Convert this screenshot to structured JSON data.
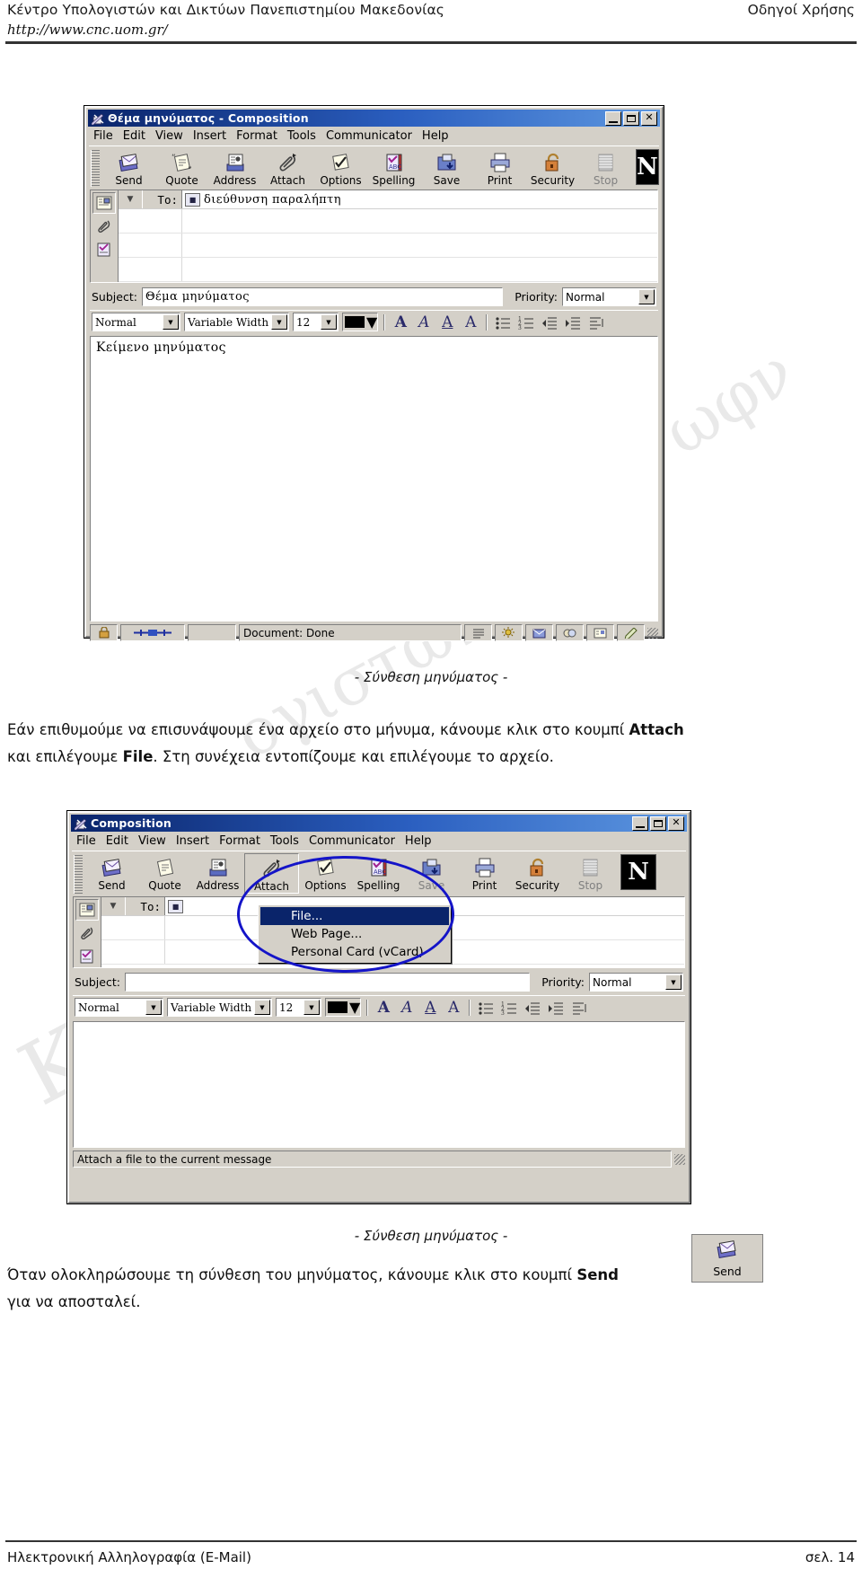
{
  "header": {
    "left": "Κέντρο Υπολογιστών και Δικτύων Πανεπιστημίου Μακεδονίας",
    "right": "Οδηγοί Χρήσης",
    "url": "http://www.cnc.uom.gr/"
  },
  "footer": {
    "left": "Ηλεκτρονική Αλληλογραφία (E-Mail)",
    "right": "σελ. 14"
  },
  "watermarks": [
    "ωφν",
    "ογιστών",
    "Κέν"
  ],
  "window1": {
    "title": "Θέμα μηνύματος - Composition",
    "title_icon": "compose-icon",
    "buttons": {
      "minimize": "_",
      "maximize": "□",
      "close": "✕"
    },
    "menu": [
      "File",
      "Edit",
      "View",
      "Insert",
      "Format",
      "Tools",
      "Communicator",
      "Help"
    ],
    "toolbar": [
      {
        "label": "Send",
        "icon": "send-icon",
        "disabled": false
      },
      {
        "label": "Quote",
        "icon": "quote-icon",
        "disabled": false
      },
      {
        "label": "Address",
        "icon": "address-icon",
        "disabled": false
      },
      {
        "label": "Attach",
        "icon": "attach-icon",
        "disabled": false
      },
      {
        "label": "Options",
        "icon": "options-icon",
        "disabled": false
      },
      {
        "label": "Spelling",
        "icon": "spelling-icon",
        "disabled": false
      },
      {
        "label": "Save",
        "icon": "save-icon",
        "disabled": false
      },
      {
        "label": "Print",
        "icon": "print-icon",
        "disabled": false
      },
      {
        "label": "Security",
        "icon": "security-icon",
        "disabled": false
      },
      {
        "label": "Stop",
        "icon": "stop-icon",
        "disabled": true
      }
    ],
    "logo": "N",
    "address": {
      "side_icons": [
        "address-card-icon",
        "paperclip-icon",
        "options-card-icon"
      ],
      "caret": "▼",
      "to_label": "To:",
      "recipient_icon": "person-card-icon",
      "recipient_value": "διεύθυνση παραλήπτη"
    },
    "subject_label": "Subject:",
    "subject_value": "Θέμα μηνύματος",
    "priority_label": "Priority:",
    "priority_value": "Normal",
    "format": {
      "style": "Normal",
      "font": "Variable Width",
      "size": "12",
      "color": "#000000",
      "icons": [
        "bold-A-icon",
        "italic-A-icon",
        "underline-A-icon",
        "font-color-icon",
        "bullet-list-icon",
        "numbered-list-icon",
        "outdent-icon",
        "indent-icon",
        "align-icon"
      ]
    },
    "body_text": "Κείμενο μηνύματος",
    "status": {
      "lock_icon": "lock-icon",
      "progress_icon": "progress-icon",
      "text": "Document: Done",
      "tray_icons": [
        "list-icon",
        "weather-icon",
        "inbox-icon",
        "news-icon",
        "contacts-icon",
        "composer-icon"
      ]
    }
  },
  "caption1": "- Σύνθεση μηνύματος -",
  "paragraph1": {
    "line1_a": "Εάν επιθυμούμε να επισυνάψουμε ένα αρχείο στο μήνυμα, κάνουμε κλικ στο κουμπί ",
    "line1_b": "Attach",
    "line2_a": "και επιλέγουμε ",
    "line2_b": "File",
    "line2_c": ". Στη συνέχεια εντοπίζουμε και επιλέγουμε το αρχείο."
  },
  "window2": {
    "title": "Composition",
    "title_icon": "compose-icon",
    "buttons": {
      "minimize": "_",
      "maximize": "□",
      "close": "✕"
    },
    "menu": [
      "File",
      "Edit",
      "View",
      "Insert",
      "Format",
      "Tools",
      "Communicator",
      "Help"
    ],
    "toolbar": [
      {
        "label": "Send",
        "icon": "send-icon",
        "disabled": false
      },
      {
        "label": "Quote",
        "icon": "quote-icon",
        "disabled": false
      },
      {
        "label": "Address",
        "icon": "address-icon",
        "disabled": false
      },
      {
        "label": "Attach",
        "icon": "attach-icon",
        "disabled": false
      },
      {
        "label": "Options",
        "icon": "options-icon",
        "disabled": false
      },
      {
        "label": "Spelling",
        "icon": "spelling-icon",
        "disabled": false
      },
      {
        "label": "Save",
        "icon": "save-icon",
        "disabled": true
      },
      {
        "label": "Print",
        "icon": "print-icon",
        "disabled": false
      },
      {
        "label": "Security",
        "icon": "security-icon",
        "disabled": false
      },
      {
        "label": "Stop",
        "icon": "stop-icon",
        "disabled": true
      }
    ],
    "logo": "N",
    "attach_menu": [
      {
        "label": "File...",
        "selected": true
      },
      {
        "label": "Web Page...",
        "selected": false
      },
      {
        "label": "Personal Card (vCard)",
        "selected": false
      }
    ],
    "address": {
      "caret": "▼",
      "to_label": "To:",
      "recipient_icon": "person-card-icon",
      "recipient_value": ""
    },
    "subject_label": "Subject:",
    "subject_value": "",
    "priority_label": "Priority:",
    "priority_value": "Normal",
    "format": {
      "style": "Normal",
      "font": "Variable Width",
      "size": "12",
      "color": "#000000"
    },
    "body_text": "",
    "status_text": "Attach a file to the current message"
  },
  "caption2": "- Σύνθεση μηνύματος -",
  "paragraph2": {
    "line1_a": "Όταν ολοκληρώσουμε τη σύνθεση του μηνύματος, κάνουμε κλικ στο κουμπί ",
    "line1_b": "Send",
    "line2": "για να αποσταλεί."
  },
  "send_thumb": {
    "label": "Send",
    "icon": "send-icon"
  }
}
